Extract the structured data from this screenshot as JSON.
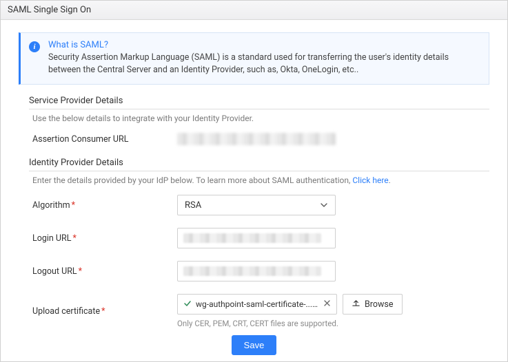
{
  "window": {
    "title": "SAML Single Sign On"
  },
  "info": {
    "heading": "What is SAML?",
    "body": "Security Assertion Markup Language (SAML) is a standard used for transferring the user's identity details between the Central Server and an Identity Provider, such as, Okta, OneLogin, etc.."
  },
  "sp": {
    "header": "Service Provider Details",
    "hint": "Use the below details to integrate with your Identity Provider.",
    "assertion_label": "Assertion Consumer URL"
  },
  "idp": {
    "header": "Identity Provider Details",
    "hint_prefix": "Enter the details provided by your IdP below. To learn more about SAML authentication, ",
    "hint_link": "Click here",
    "hint_suffix": ".",
    "algorithm_label": "Algorithm",
    "algorithm_value": "RSA",
    "login_label": "Login URL",
    "logout_label": "Logout URL",
    "upload_label": "Upload certificate",
    "file_name": "wg-authpoint-saml-certificate-....cer",
    "browse_label": "Browse",
    "file_hint": "Only CER, PEM, CRT, CERT files are supported."
  },
  "actions": {
    "save": "Save"
  }
}
